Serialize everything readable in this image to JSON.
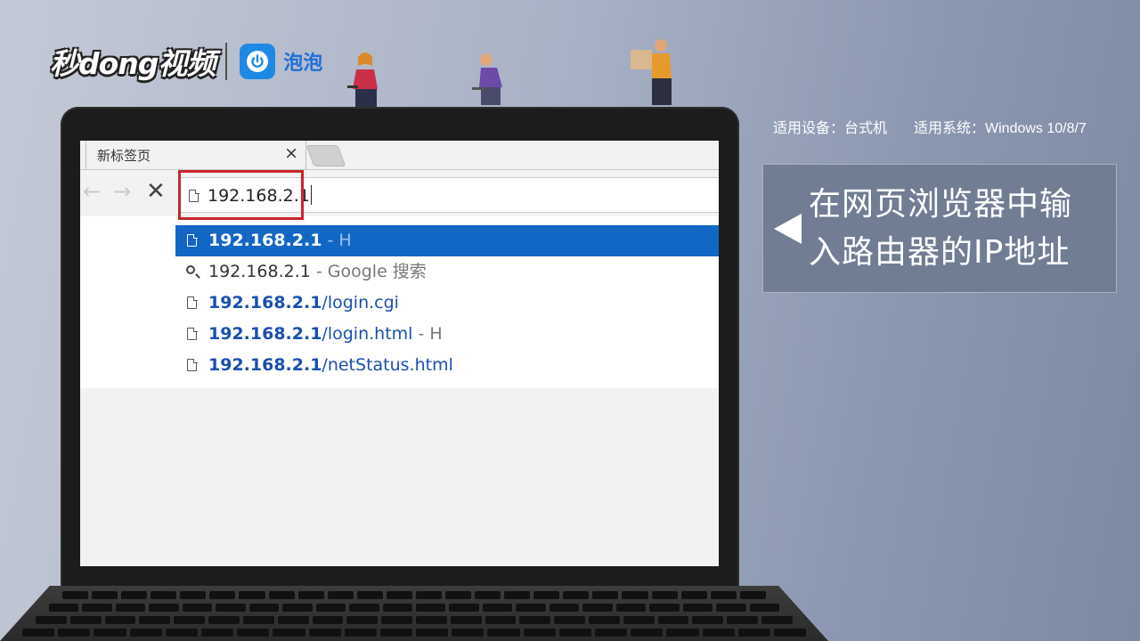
{
  "brand": {
    "logo_text": "秒dong视频",
    "partner_label": "泡泡"
  },
  "device_info": {
    "device": "适用设备：台式机",
    "system": "适用系统：Windows 10/8/7"
  },
  "callout": {
    "line1": "在网页浏览器中输",
    "line2": "入路由器的IP地址"
  },
  "browser": {
    "tab_title": "新标签页",
    "tab_close": "×",
    "nav": {
      "back": "←",
      "forward": "→",
      "stop": "✕"
    },
    "address_value": "192.168.2.1",
    "suggestions": [
      {
        "bold": "192.168.2.1",
        "rest": "",
        "suffix": " - H",
        "icon": "page-icon",
        "selected": true
      },
      {
        "bold": "",
        "plain": "192.168.2.1",
        "suffix": " - Google 搜索",
        "icon": "search-icon",
        "selected": false
      },
      {
        "bold": "192.168.2.1",
        "rest": "/login.cgi",
        "suffix": "",
        "icon": "page-icon",
        "selected": false
      },
      {
        "bold": "192.168.2.1",
        "rest": "/login.html",
        "suffix": " - H",
        "icon": "page-icon",
        "selected": false
      },
      {
        "bold": "192.168.2.1",
        "rest": "/netStatus.html",
        "suffix": "",
        "icon": "page-icon",
        "selected": false
      }
    ]
  },
  "colors": {
    "highlight_border": "#c9252b",
    "selected_row": "#1267c5",
    "link_blue": "#1a4fb0",
    "callout_bg": "#717d93"
  }
}
